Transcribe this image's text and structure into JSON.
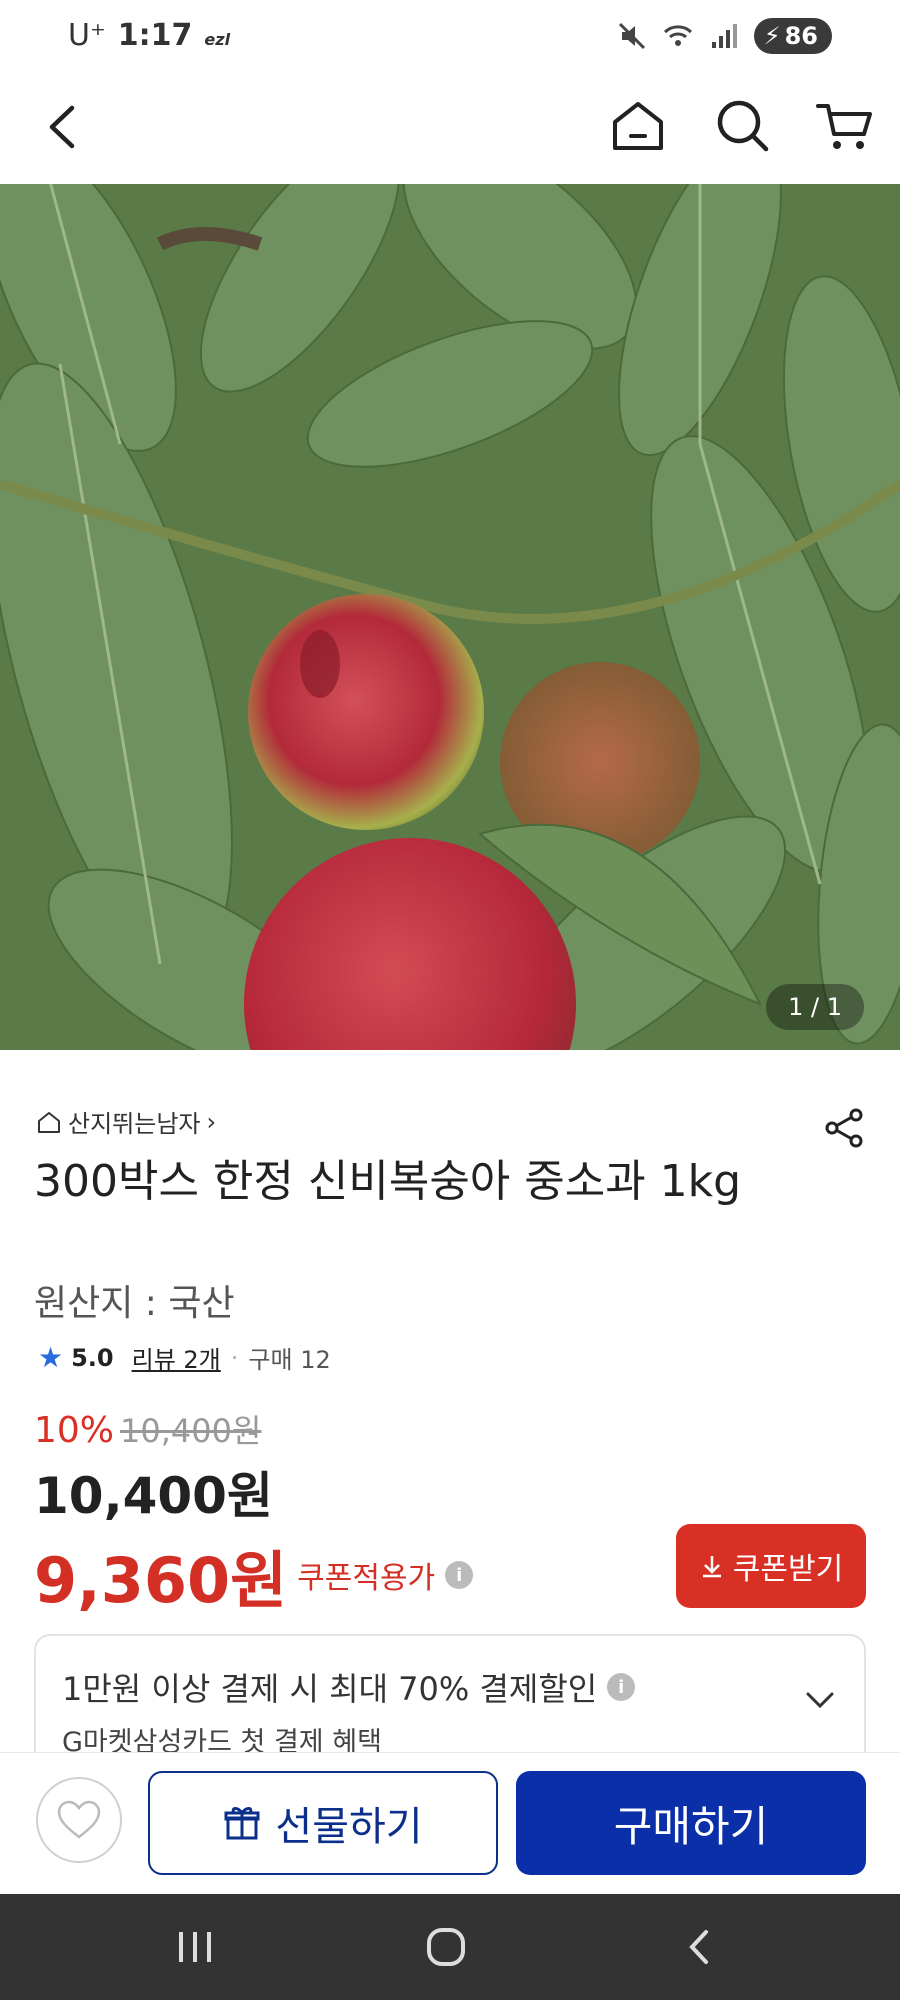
{
  "status_bar": {
    "carrier": "U⁺",
    "time": "1:17",
    "badge": "ezl",
    "battery": "86"
  },
  "product": {
    "image_counter": "1 / 1",
    "seller": "산지뛰는남자",
    "title": "300박스 한정 신비복숭아 중소과 1kg",
    "origin": "원산지 : 국산",
    "rating": "5.0",
    "reviews": "리뷰 2개",
    "purchases": "구매 12",
    "discount_rate": "10%",
    "original_price": "10,400원",
    "sale_price": "10,400원",
    "coupon_price": "9,360원",
    "coupon_price_label": "쿠폰적용가",
    "coupon_button": "쿠폰받기"
  },
  "promo": {
    "line1": "1만원 이상 결제 시 최대  70% 결제할인",
    "line2": "G마켓삼성카드 첫 결제 혜택"
  },
  "actions": {
    "gift": "선물하기",
    "buy": "구매하기"
  },
  "colors": {
    "accent_red": "#d93025",
    "accent_blue": "#0a2fa8"
  }
}
